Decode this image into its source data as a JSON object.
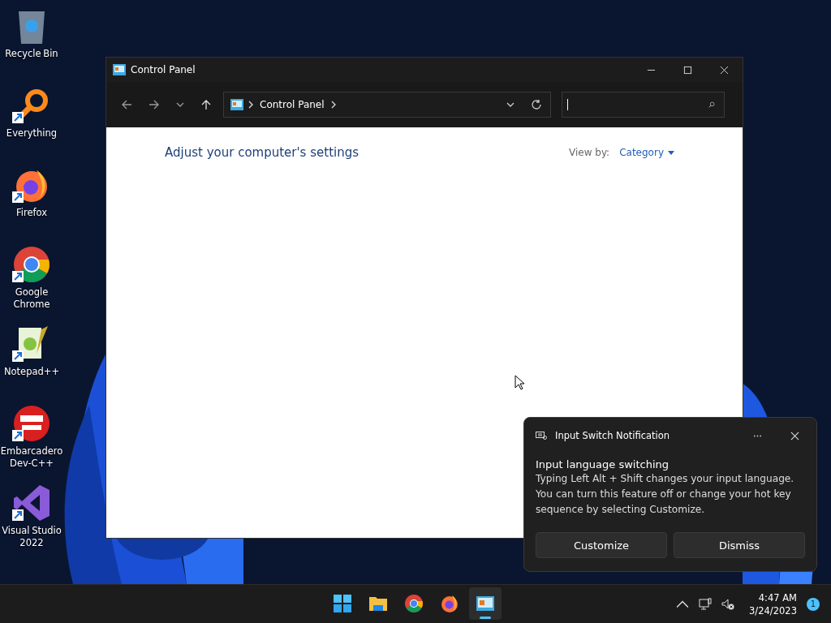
{
  "desktop_icons": [
    {
      "label": "Recycle Bin",
      "kind": "recycle",
      "shortcut": false
    },
    {
      "label": "Everything",
      "kind": "everything",
      "shortcut": true
    },
    {
      "label": "Firefox",
      "kind": "firefox",
      "shortcut": true
    },
    {
      "label": "Google Chrome",
      "kind": "chrome",
      "shortcut": true
    },
    {
      "label": "Notepad++",
      "kind": "notepad",
      "shortcut": true
    },
    {
      "label": "Embarcadero Dev-C++",
      "kind": "devcpp",
      "shortcut": true
    },
    {
      "label": "Visual Studio 2022",
      "kind": "vs",
      "shortcut": true
    }
  ],
  "window": {
    "title": "Control Panel",
    "breadcrumb": "Control Panel",
    "heading": "Adjust your computer's settings",
    "view_by_label": "View by:",
    "view_by_value": "Category"
  },
  "notification": {
    "app": "Input Switch Notification",
    "title": "Input language switching",
    "body": "Typing Left Alt + Shift changes your input language. You can turn this feature off or change your hot key sequence by selecting Customize.",
    "buttons": [
      "Customize",
      "Dismiss"
    ]
  },
  "taskbar": {
    "apps": [
      {
        "kind": "start",
        "selected": false
      },
      {
        "kind": "folder",
        "selected": false
      },
      {
        "kind": "chrome",
        "selected": false
      },
      {
        "kind": "firefox",
        "selected": false
      },
      {
        "kind": "control-panel",
        "selected": true
      }
    ],
    "time": "4:47 AM",
    "date": "3/24/2023",
    "badge": "1"
  }
}
